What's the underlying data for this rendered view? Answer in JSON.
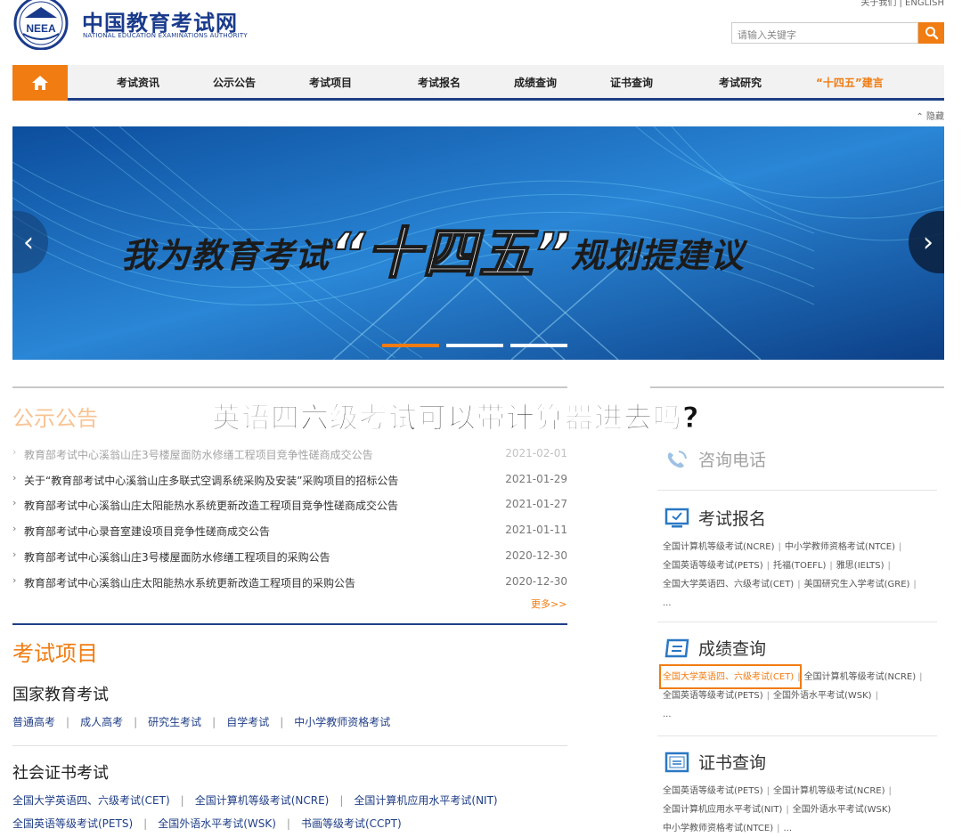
{
  "header": {
    "title_cn": "中国教育考试网",
    "title_en": "NATIONAL EDUCATION EXAMINATIONS AUTHORITY",
    "emblem_text": "NEEA",
    "top_links": "关于我们 | ENGLISH",
    "search_placeholder": "请输入关键字"
  },
  "nav": {
    "items": [
      "考试资讯",
      "公示公告",
      "考试项目",
      "考试报名",
      "成绩查询",
      "证书查询",
      "考试研究",
      "“十四五”建言"
    ],
    "hide_label": "隐藏"
  },
  "banner": {
    "text_before": "我为教育考试",
    "text_big": "“十四五”",
    "text_after": "规划提建议"
  },
  "overlay_question": "英语四六级考试可以带计算器进去吗?",
  "notices": {
    "title": "公示公告",
    "items": [
      {
        "text": "教育部考试中心溪翁山庄3号楼屋面防水修缮工程项目竞争性磋商成交公告",
        "date": "2021-02-01"
      },
      {
        "text": "关于“教育部考试中心溪翁山庄多联式空调系统采购及安装”采购项目的招标公告",
        "date": "2021-01-29"
      },
      {
        "text": "教育部考试中心溪翁山庄太阳能热水系统更新改造工程项目竞争性磋商成交公告",
        "date": "2021-01-27"
      },
      {
        "text": "教育部考试中心录音室建设项目竞争性磋商成交公告",
        "date": "2021-01-11"
      },
      {
        "text": "教育部考试中心溪翁山庄3号楼屋面防水修缮工程项目的采购公告",
        "date": "2020-12-30"
      },
      {
        "text": "教育部考试中心溪翁山庄太阳能热水系统更新改造工程项目的采购公告",
        "date": "2020-12-30"
      }
    ],
    "more": "更多>>"
  },
  "exams": {
    "title": "考试项目",
    "national": {
      "title": "国家教育考试",
      "links": [
        "普通高考",
        "成人高考",
        "研究生考试",
        "自学考试",
        "中小学教师资格考试"
      ]
    },
    "social": {
      "title": "社会证书考试",
      "links_row1": [
        "全国大学英语四、六级考试(CET)",
        "全国计算机等级考试(NCRE)",
        "全国计算机应用水平考试(NIT)"
      ],
      "links_row2": [
        "全国英语等级考试(PETS)",
        "全国外语水平考试(WSK)",
        "书画等级考试(CCPT)"
      ]
    }
  },
  "right": {
    "phone": {
      "title": "咨询电话"
    },
    "register": {
      "title": "考试报名",
      "lines": [
        [
          "全国计算机等级考试(NCRE)",
          "中小学教师资格考试(NTCE)"
        ],
        [
          "全国英语等级考试(PETS)",
          "托福(TOEFL)",
          "雅思(IELTS)"
        ],
        [
          "全国大学英语四、六级考试(CET)",
          "美国研究生入学考试(GRE)"
        ]
      ],
      "ellipsis": "..."
    },
    "score": {
      "title": "成绩查询",
      "lines": [
        [
          "全国大学英语四、六级考试(CET)",
          "全国计算机等级考试(NCRE)"
        ],
        [
          "全国英语等级考试(PETS)",
          "全国外语水平考试(WSK)"
        ]
      ],
      "ellipsis": "..."
    },
    "cert": {
      "title": "证书查询",
      "lines": [
        [
          "全国英语等级考试(PETS)",
          "全国计算机等级考试(NCRE)"
        ],
        [
          "全国计算机应用水平考试(NIT)",
          "全国外语水平考试(WSK)"
        ],
        [
          "中小学教师资格考试(NTCE)",
          "..."
        ]
      ]
    }
  },
  "colors": {
    "accent": "#f07c12",
    "brand_blue": "#1f3e86",
    "banner_blue": "#1665b9"
  }
}
